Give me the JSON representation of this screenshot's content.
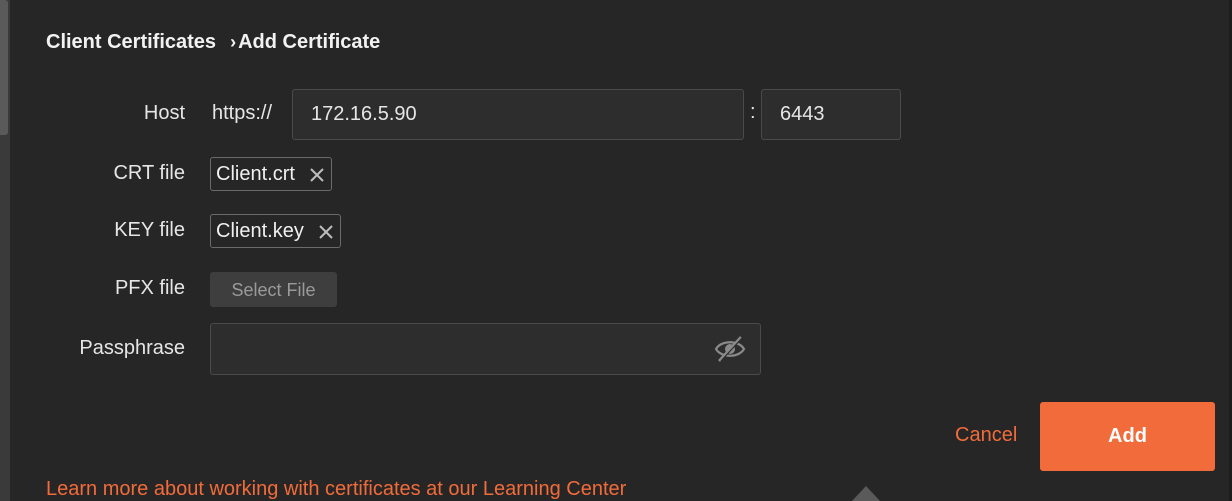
{
  "breadcrumb": {
    "parent": "Client Certificates",
    "separator": "›",
    "current": "Add Certificate"
  },
  "host": {
    "label": "Host",
    "scheme": "https://",
    "address": "172.16.5.90",
    "colon": ":",
    "port": "6443"
  },
  "crt": {
    "label": "CRT file",
    "filename": "Client.crt",
    "remove_icon": "close-icon"
  },
  "key": {
    "label": "KEY file",
    "filename": "Client.key",
    "remove_icon": "close-icon"
  },
  "pfx": {
    "label": "PFX file",
    "button_label": "Select File"
  },
  "passphrase": {
    "label": "Passphrase",
    "value": "",
    "toggle_icon": "eye-slash-icon"
  },
  "actions": {
    "cancel_label": "Cancel",
    "add_label": "Add"
  },
  "footer": {
    "learn_more": "Learn more about working with certificates at our Learning Center"
  },
  "colors": {
    "accent": "#f26b3a",
    "background": "#262626",
    "input_bg": "#2d2d2d"
  }
}
